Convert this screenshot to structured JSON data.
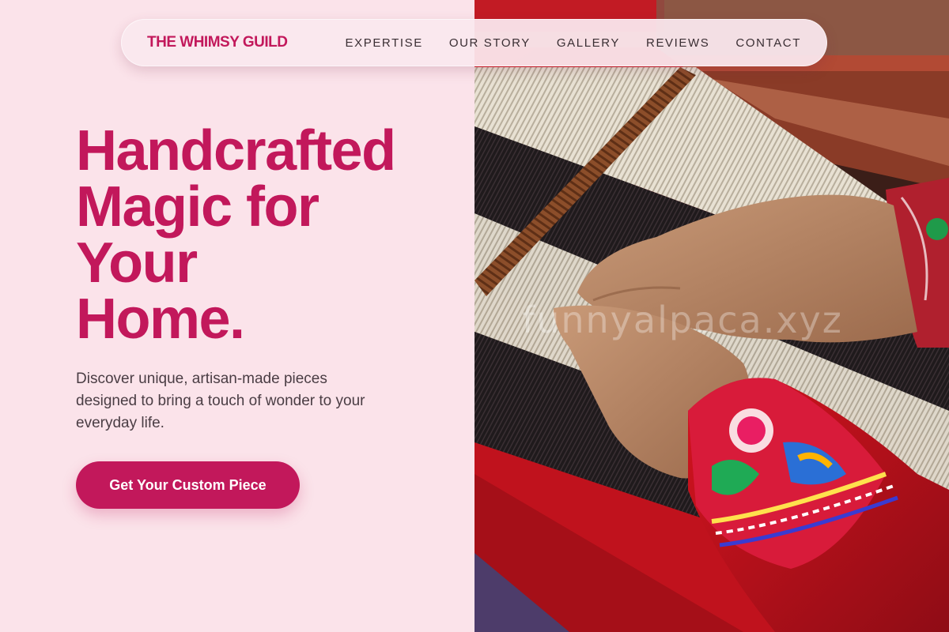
{
  "header": {
    "brand": "THE WHIMSY GUILD",
    "nav": [
      {
        "label": "EXPERTISE"
      },
      {
        "label": "OUR STORY"
      },
      {
        "label": "GALLERY"
      },
      {
        "label": "REVIEWS"
      },
      {
        "label": "CONTACT"
      }
    ]
  },
  "hero": {
    "title_lines": [
      "Handcrafted",
      "Magic for",
      "Your",
      "Home."
    ],
    "subtitle": "Discover unique, artisan-made pieces designed to bring a touch of wonder to your everyday life.",
    "cta_label": "Get Your Custom Piece"
  },
  "image": {
    "watermark": "funnyalpaca.xyz"
  },
  "colors": {
    "background": "#fbe3ea",
    "accent": "#c2185b",
    "text": "#4a3d44"
  }
}
